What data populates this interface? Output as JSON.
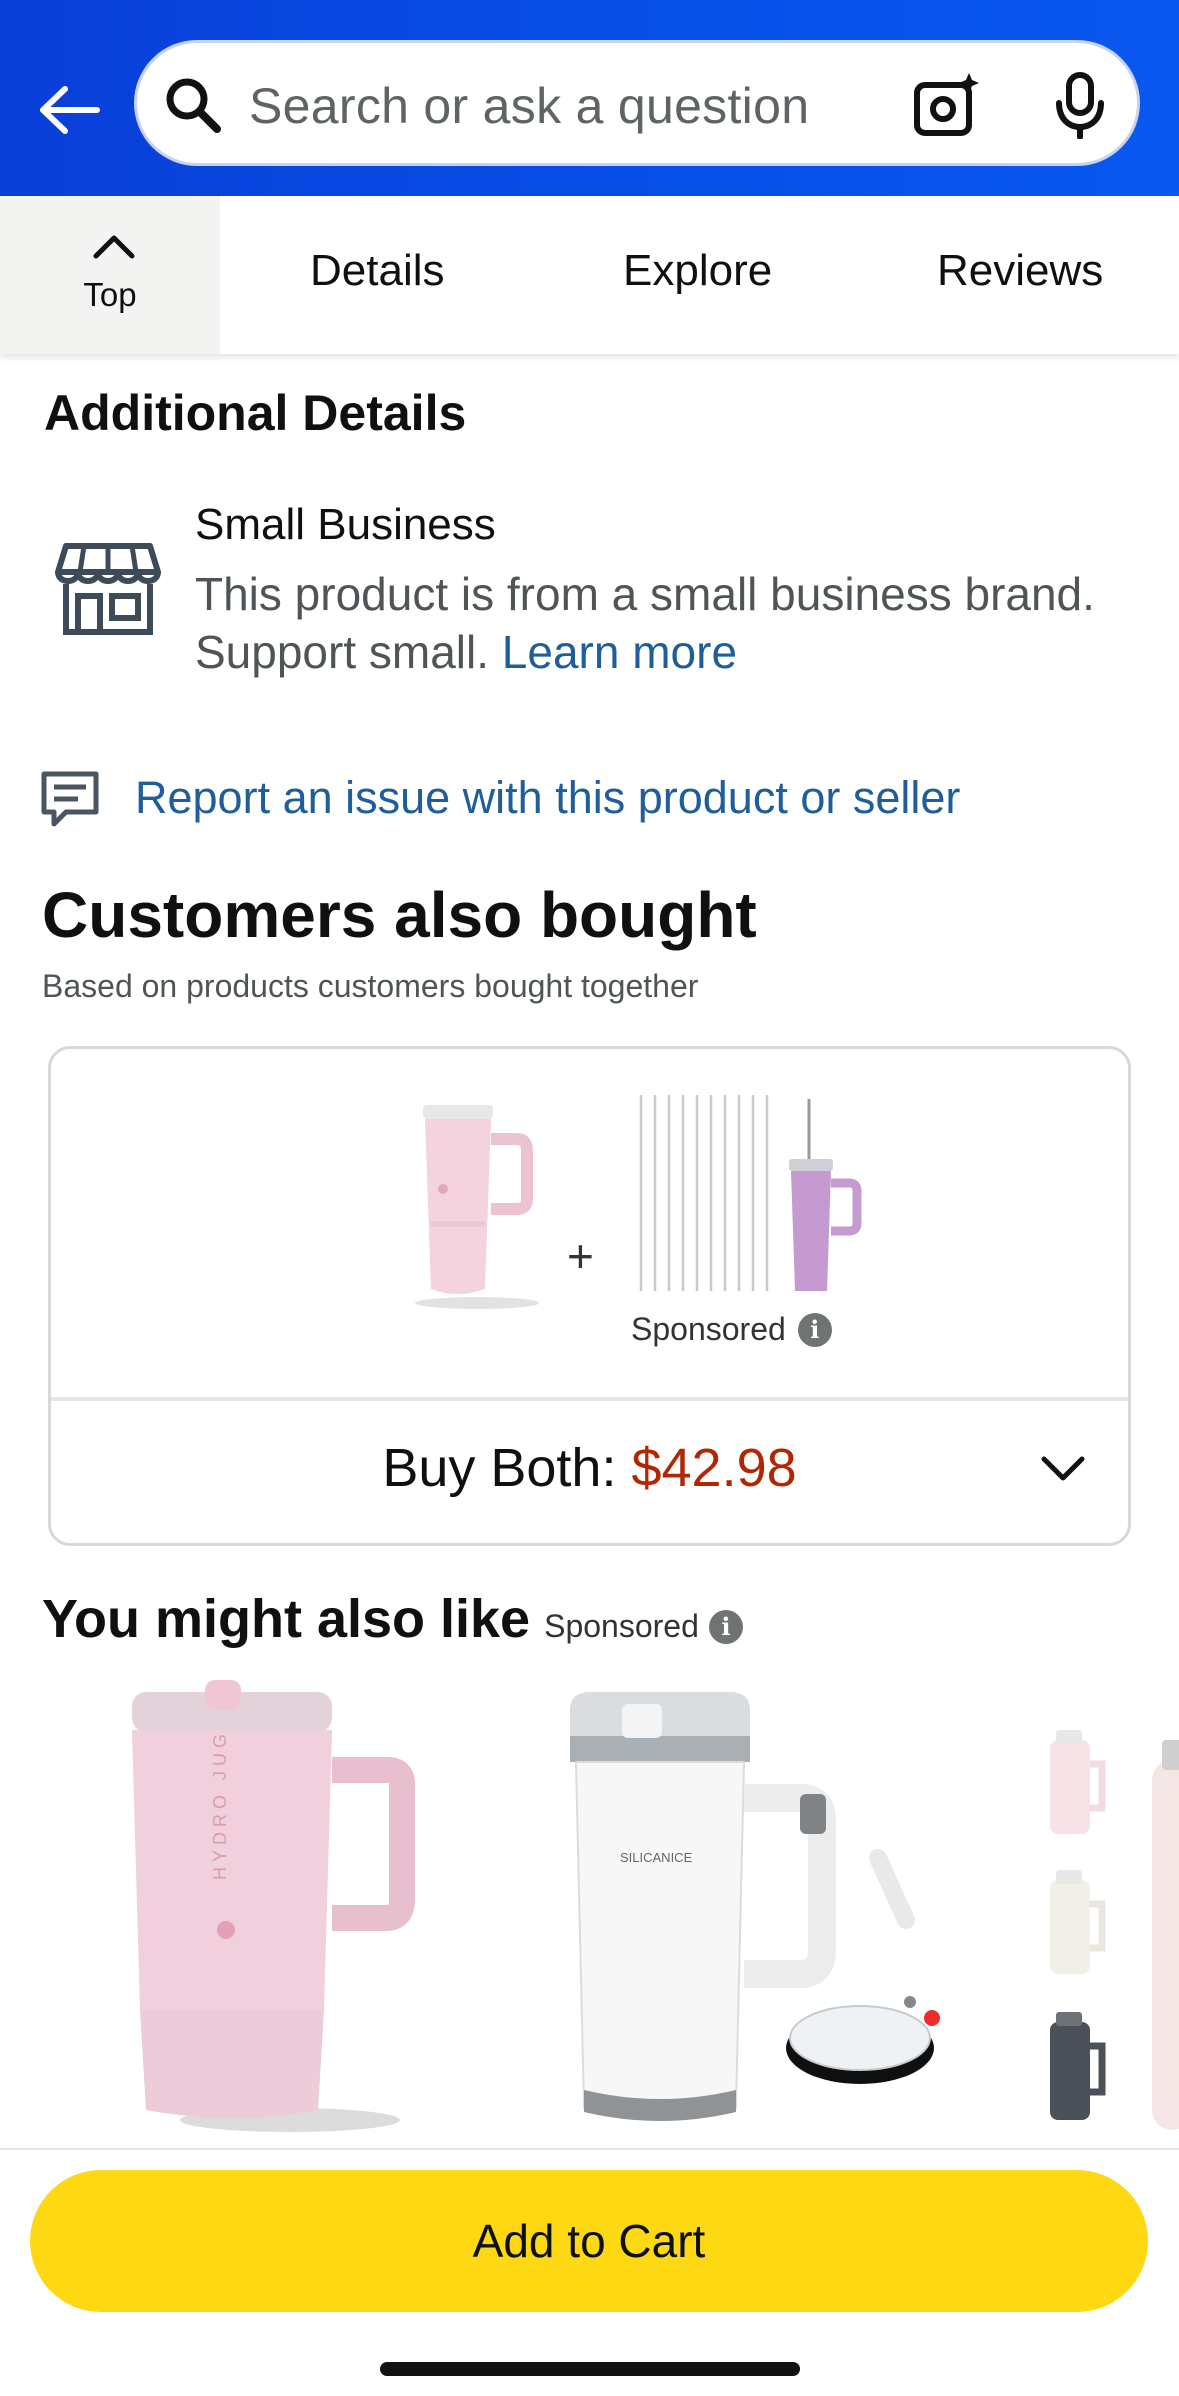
{
  "header": {
    "search_placeholder": "Search or ask a question",
    "back_icon": "back-arrow-icon",
    "search_icon": "search-icon",
    "camera_icon": "camera-sparkle-icon",
    "mic_icon": "microphone-icon"
  },
  "tabs": {
    "top": "Top",
    "details": "Details",
    "explore": "Explore",
    "reviews": "Reviews"
  },
  "additional": {
    "heading": "Additional Details",
    "small_business_title": "Small Business",
    "small_business_desc": "This product is from a small business brand. Support small.",
    "learn_more": "Learn more"
  },
  "report": {
    "text": "Report an issue with this product or seller"
  },
  "customers_also_bought": {
    "heading": "Customers also bought",
    "subheading": "Based on products customers bought together",
    "plus": "+",
    "sponsored": "Sponsored",
    "buy_both_label": "Buy Both:",
    "buy_both_price": "$42.98"
  },
  "you_might_also_like": {
    "heading": "You might also like",
    "sponsored": "Sponsored"
  },
  "product_text": {
    "brand_a": "HYDRO JUG",
    "brand_b": "SILICANICE"
  },
  "info_glyph": "i",
  "bottom": {
    "add_to_cart": "Add to Cart"
  },
  "colors": {
    "header_blue": "#0650e8",
    "link_blue": "#1f5e9a",
    "price_red": "#b12704",
    "cart_yellow": "#ffd814"
  }
}
